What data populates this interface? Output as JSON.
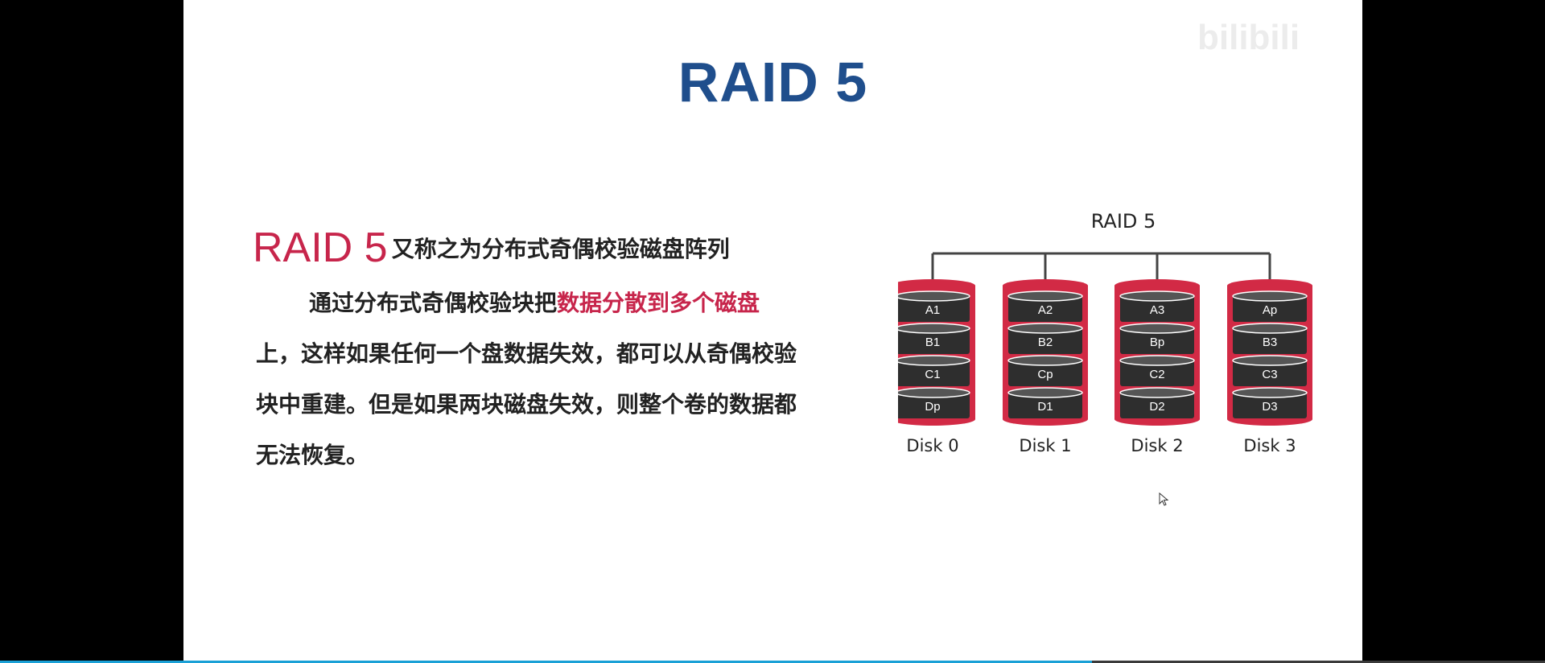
{
  "slide": {
    "title": "RAID 5",
    "watermark": "bilibili"
  },
  "content": {
    "heading_raid": "RAID 5",
    "heading_rest": "又称之为分布式奇偶校验磁盘阵列",
    "para_part1": "通过分布式奇偶校验块把",
    "para_highlight": "数据分散到多个磁盘",
    "para_part2": "上，这样如果任何一个盘数据失效，都可以从奇偶校验块中重建。但是如果两块磁盘失效，则整个卷的数据都无法恢复。"
  },
  "diagram": {
    "title": "RAID 5",
    "disks": [
      {
        "label": "Disk 0",
        "blocks": [
          "A1",
          "B1",
          "C1",
          "Dp"
        ]
      },
      {
        "label": "Disk 1",
        "blocks": [
          "A2",
          "B2",
          "Cp",
          "D1"
        ]
      },
      {
        "label": "Disk 2",
        "blocks": [
          "A3",
          "Bp",
          "C2",
          "D2"
        ]
      },
      {
        "label": "Disk 3",
        "blocks": [
          "Ap",
          "B3",
          "C3",
          "D3"
        ]
      }
    ],
    "colors": {
      "disk_frame": "#d22a45",
      "block": "#2e2e2e",
      "block_text": "#ffffff",
      "line": "#444444"
    }
  },
  "player": {
    "progress_fraction": 0.707
  }
}
